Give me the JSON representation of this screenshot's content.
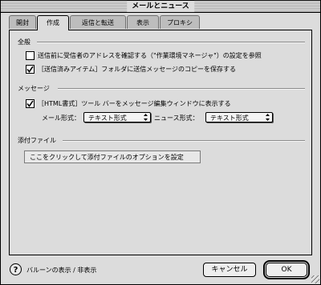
{
  "window": {
    "title": "メールとニュース"
  },
  "tabs": [
    {
      "label": "開封"
    },
    {
      "label": "作成"
    },
    {
      "label": "返信と転送"
    },
    {
      "label": "表示"
    },
    {
      "label": "プロキシ"
    }
  ],
  "active_tab": "作成",
  "general": {
    "label": "全般",
    "check_address": {
      "label": "送信前に受信者のアドレスを確認する（\"作業環境マネージャ\"）の設定を参照",
      "checked": false
    },
    "save_copy": {
      "label": "［送信済みアイテム］フォルダに送信メッセージのコピーを保存する",
      "checked": true
    }
  },
  "message": {
    "label": "メッセージ",
    "html_toolbar": {
      "label": "［HTML書式］ツール バーをメッセージ編集ウィンドウに表示する",
      "checked": true
    },
    "mail_format_label": "メール形式：",
    "mail_format_value": "テキスト形式",
    "news_format_label": "ニュース形式：",
    "news_format_value": "テキスト形式"
  },
  "attachments": {
    "label": "添付ファイル",
    "options_button": "ここをクリックして添付ファイルのオプションを設定"
  },
  "footer": {
    "balloon_toggle": "バルーンの表示 / 非表示",
    "cancel_label": "キャンセル",
    "ok_label": "OK"
  }
}
